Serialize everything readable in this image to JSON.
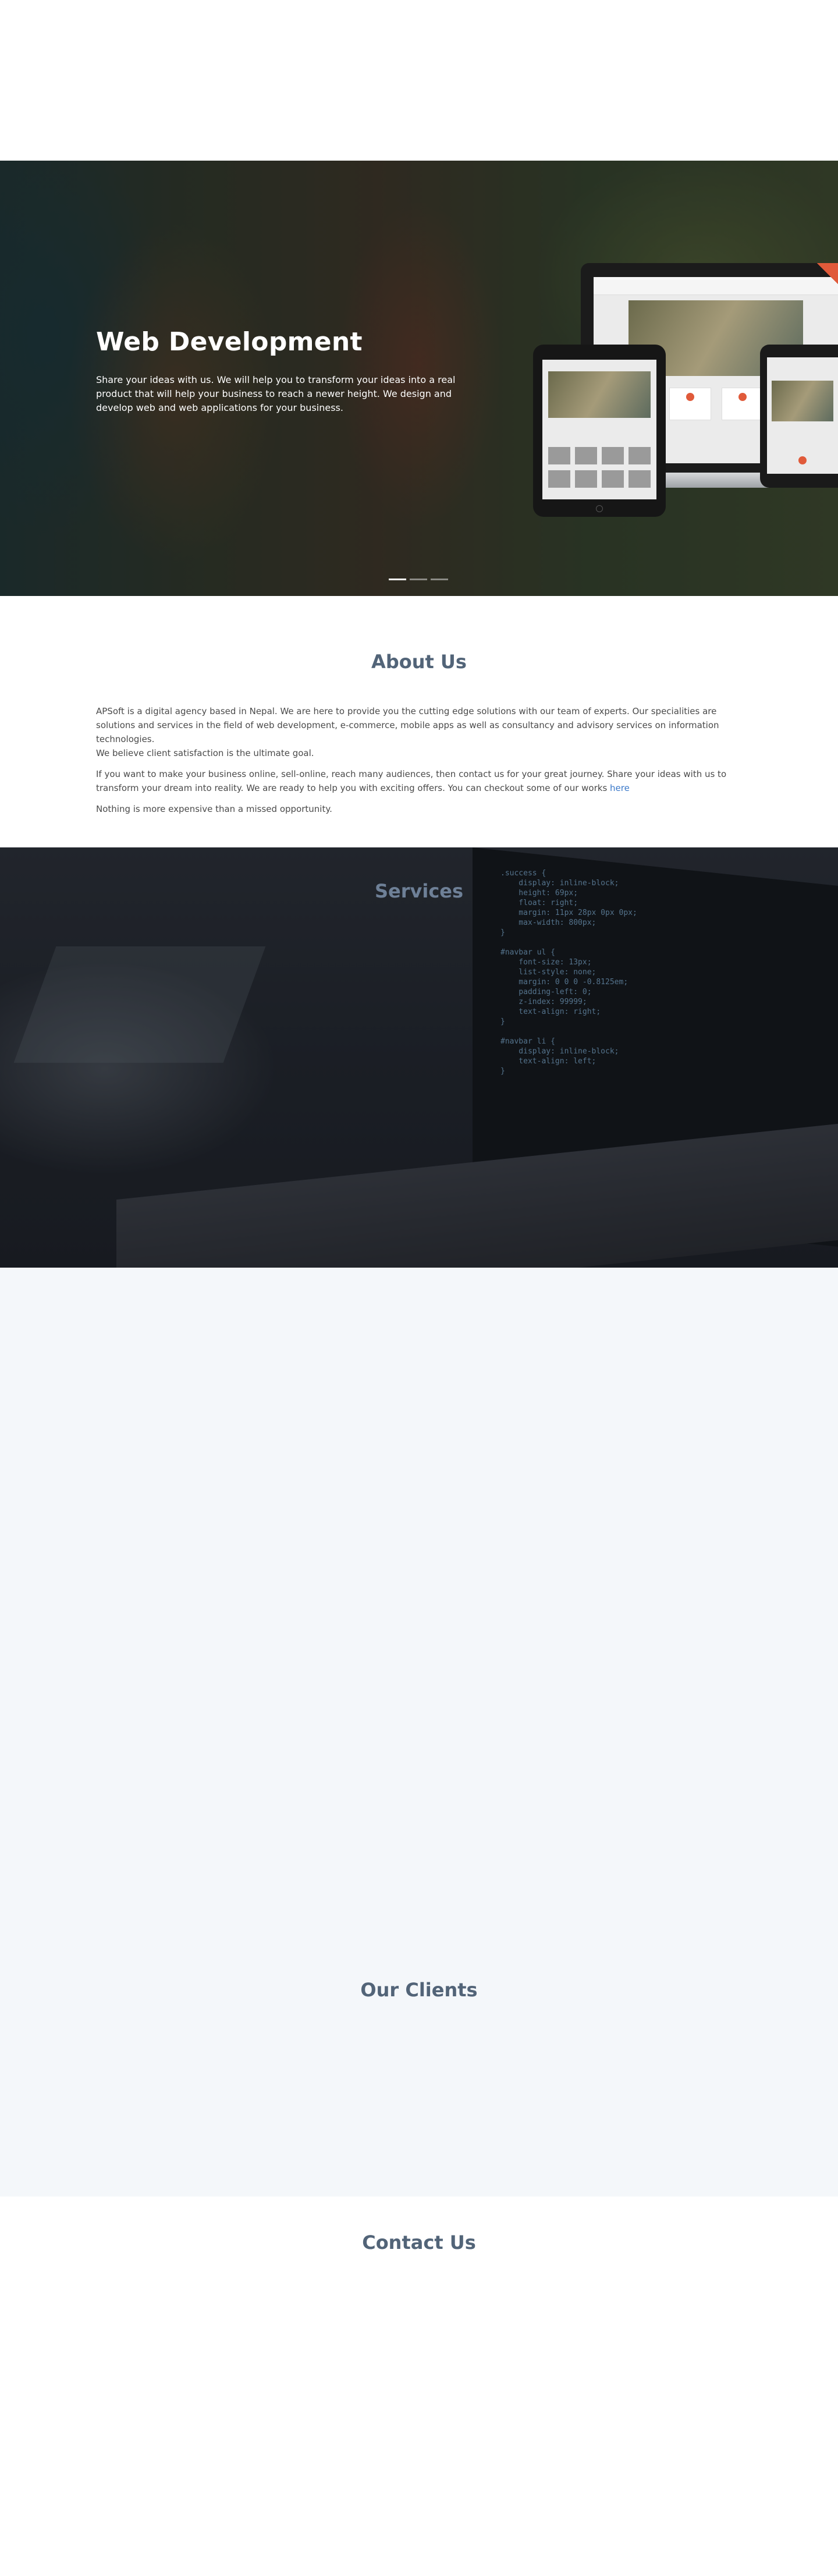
{
  "hero": {
    "title": "Web Development",
    "text": "Share your ideas with us. We will help you to transform your ideas into a real product that will help your business to reach a newer height. We design and develop web and web applications for your business.",
    "slide_count": 3,
    "active_slide": 1
  },
  "about": {
    "title": "About Us",
    "p1": "APSoft is a digital agency based in Nepal. We are here to provide you the cutting edge solutions with our team of experts. Our specialities are solutions and services in the field of web development, e-commerce, mobile apps as well as consultancy and advisory services on information technologies.",
    "p1b": "We believe client satisfaction is the ultimate goal.",
    "p2": "If you want to make your business online, sell-online, reach many audiences, then contact us for your great journey. Share your ideas with us to transform your dream into reality. We are ready to help you with exciting offers. You can checkout some of our works",
    "p2_link": "here",
    "p3": "Nothing is more expensive than a missed opportunity."
  },
  "services": {
    "title": "Services"
  },
  "clients": {
    "title": "Our Clients"
  },
  "contact": {
    "title": "Contact Us"
  },
  "colors": {
    "heading": "#526478",
    "link": "#3a78c9",
    "clients_bg": "#f4f7fa"
  }
}
